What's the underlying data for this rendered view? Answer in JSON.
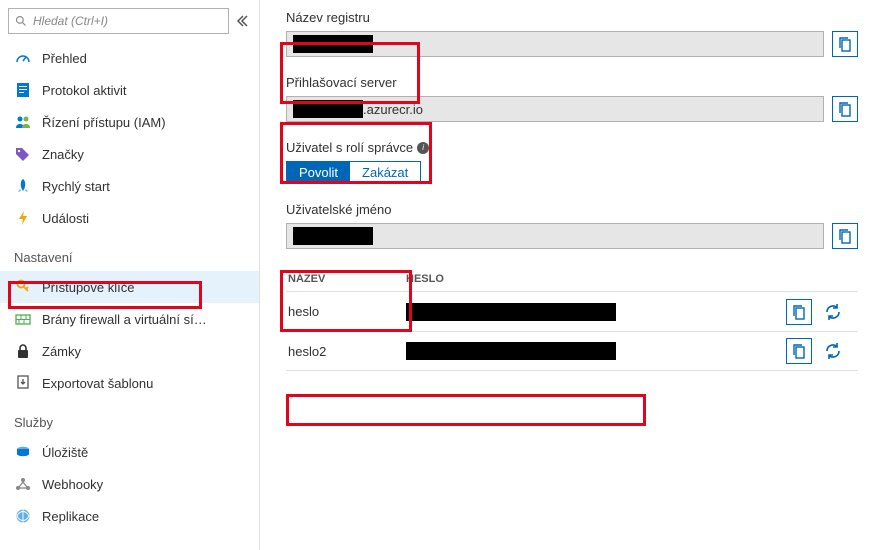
{
  "search": {
    "placeholder": "Hledat (Ctrl+I)"
  },
  "sidebar": {
    "top_items": [
      {
        "icon": "gauge-icon",
        "label": "Přehled"
      },
      {
        "icon": "log-icon",
        "label": "Protokol aktivit"
      },
      {
        "icon": "iam-icon",
        "label": "Řízení přístupu (IAM)"
      },
      {
        "icon": "tag-icon",
        "label": "Značky"
      },
      {
        "icon": "rocket-icon",
        "label": "Rychlý start"
      },
      {
        "icon": "bolt-icon",
        "label": "Události"
      }
    ],
    "sections": [
      {
        "title": "Nastavení",
        "items": [
          {
            "icon": "key-icon",
            "label": "Přístupové klíče",
            "selected": true
          },
          {
            "icon": "firewall-icon",
            "label": "Brány firewall a virtuální sí…"
          },
          {
            "icon": "lock-icon",
            "label": "Zámky"
          },
          {
            "icon": "export-icon",
            "label": "Exportovat šablonu"
          }
        ]
      },
      {
        "title": "Služby",
        "items": [
          {
            "icon": "storage-icon",
            "label": "Úložiště"
          },
          {
            "icon": "webhook-icon",
            "label": "Webhooky"
          },
          {
            "icon": "replication-icon",
            "label": "Replikace"
          }
        ]
      }
    ]
  },
  "main": {
    "registry_name_label": "Název registru",
    "login_server_label": "Přihlašovací server",
    "login_server_suffix": ".azurecr.io",
    "admin_label": "Uživatel s rolí správce",
    "toggle_enable": "Povolit",
    "toggle_disable": "Zakázat",
    "username_label": "Uživatelské jméno",
    "pw_header_name": "NÁZEV",
    "pw_header_pw": "HESLO",
    "pw_rows": [
      {
        "name": "heslo"
      },
      {
        "name": "heslo2"
      }
    ]
  }
}
